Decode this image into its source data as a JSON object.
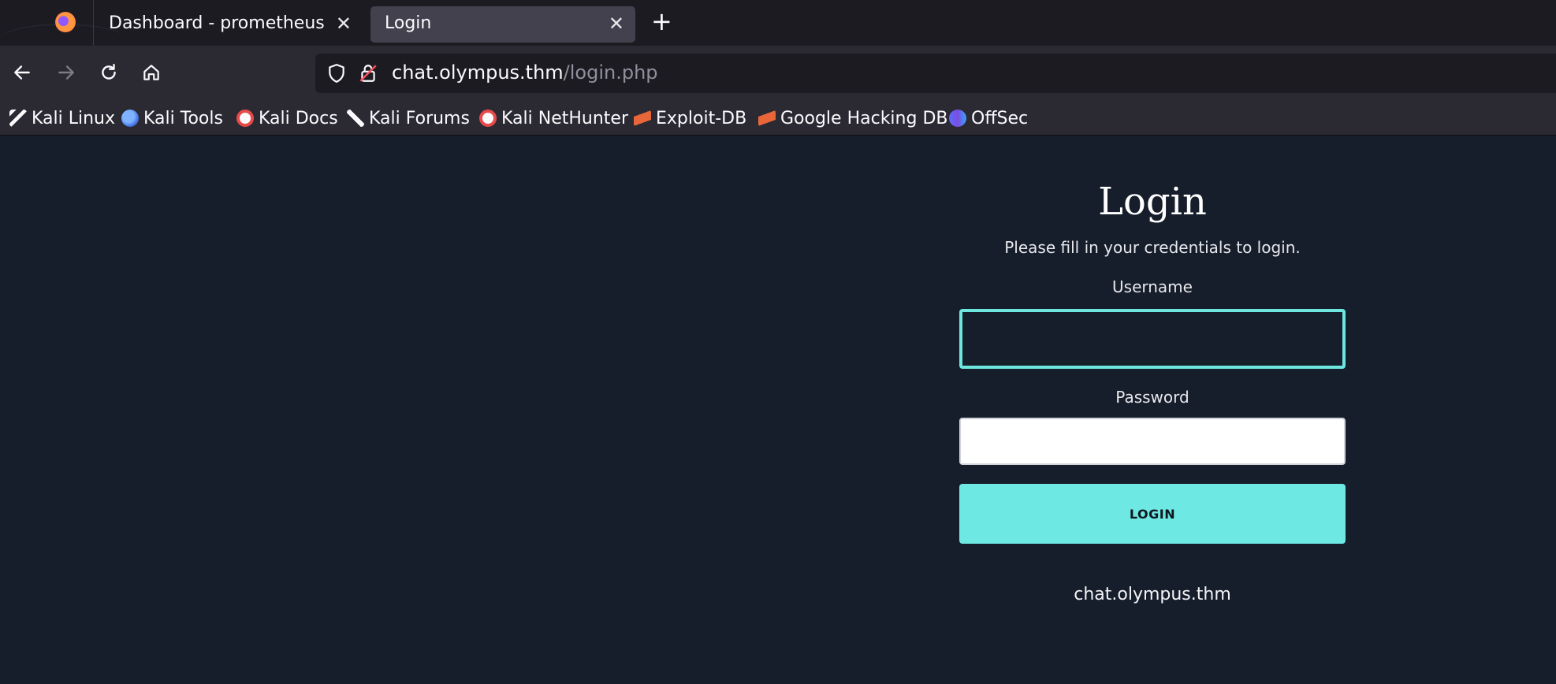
{
  "browser": {
    "tabs": [
      {
        "label": "Dashboard - prometheus",
        "active": false
      },
      {
        "label": "Login",
        "active": true
      }
    ],
    "url": {
      "host": "chat.olympus.thm",
      "path": "/login.php"
    },
    "bookmarks": [
      {
        "label": "Kali Linux",
        "icon": "kali-dragon-icon"
      },
      {
        "label": "Kali Tools",
        "icon": "kali-tools-icon"
      },
      {
        "label": "Kali Docs",
        "icon": "kali-docs-icon"
      },
      {
        "label": "Kali Forums",
        "icon": "kali-forums-icon"
      },
      {
        "label": "Kali NetHunter",
        "icon": "kali-nethunter-icon"
      },
      {
        "label": "Exploit-DB",
        "icon": "exploit-db-icon"
      },
      {
        "label": "Google Hacking DB",
        "icon": "ghdb-icon"
      },
      {
        "label": "OffSec",
        "icon": "offsec-icon"
      }
    ]
  },
  "login": {
    "title": "Login",
    "subtitle": "Please fill in your credentials to login.",
    "username_label": "Username",
    "username_value": "",
    "password_label": "Password",
    "password_value": "",
    "button_label": "LOGIN",
    "footer_host": "chat.olympus.thm"
  },
  "colors": {
    "page_bg": "#161d2b",
    "accent": "#6de8e2",
    "tab_active": "#42414d",
    "toolbar": "#2b2a33"
  }
}
